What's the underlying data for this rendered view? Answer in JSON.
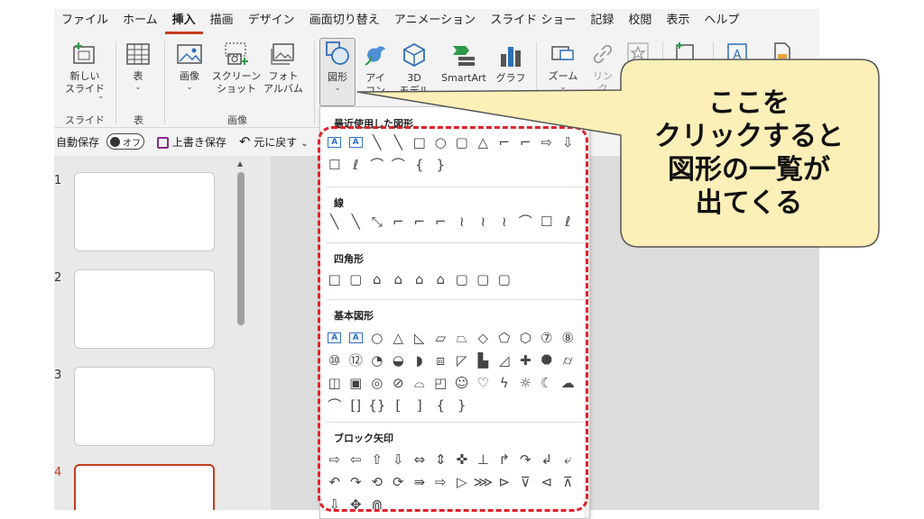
{
  "ribbon_tabs": [
    "ファイル",
    "ホーム",
    "挿入",
    "描画",
    "デザイン",
    "画面切り替え",
    "アニメーション",
    "スライド ショー",
    "記録",
    "校閲",
    "表示",
    "ヘルプ"
  ],
  "ribbon": {
    "new_slide": "新しい\nスライド",
    "table": "表",
    "image": "画像",
    "screenshot": "スクリーン\nショット",
    "photo_album": "フォト\nアルバム",
    "shapes": "図形",
    "icons": "アイ\nコン",
    "model3d": "3D\nモデル",
    "smartart": "SmartArt",
    "graph": "グラフ",
    "zoom": "ズーム",
    "link": "リン\nク",
    "group_slide": "スライド",
    "group_table": "表",
    "group_image": "画像"
  },
  "qat": {
    "autosave": "自動保存",
    "autosave_state": "オフ",
    "save": "上書き保存",
    "undo": "元に戻す"
  },
  "slides": [
    {
      "num": "1",
      "current": false
    },
    {
      "num": "2",
      "current": false
    },
    {
      "num": "3",
      "current": false
    },
    {
      "num": "4",
      "current": true
    }
  ],
  "shapes_menu": {
    "recent": {
      "title": "最近使用した図形",
      "rows": [
        [
          "A",
          "A",
          "╲",
          "╲",
          "□",
          "○",
          "▢",
          "△",
          "⌐",
          "⌐",
          "⇨",
          "⇩"
        ],
        [
          "☐",
          "ℓ",
          "⌒",
          "⌒",
          "{",
          "}"
        ]
      ]
    },
    "lines": {
      "title": "線",
      "rows": [
        [
          "╲",
          "╲",
          "⤡",
          "⌐",
          "⌐",
          "⌐",
          "≀",
          "≀",
          "≀",
          "⌒",
          "☐",
          "ℓ"
        ]
      ]
    },
    "rectangles": {
      "title": "四角形",
      "rows": [
        [
          "□",
          "▢",
          "⌂",
          "⌂",
          "⌂",
          "⌂",
          "▢",
          "▢",
          "▢"
        ]
      ]
    },
    "basic": {
      "title": "基本図形",
      "rows": [
        [
          "A",
          "A",
          "○",
          "△",
          "◺",
          "▱",
          "⏢",
          "◇",
          "⬠",
          "⬡",
          "⑦",
          "⑧"
        ],
        [
          "⑩",
          "⑫",
          "◔",
          "◒",
          "◗",
          "⧈",
          "◸",
          "▙",
          "◿",
          "✚",
          "⯃",
          "⌭"
        ],
        [
          "◫",
          "▣",
          "◎",
          "⊘",
          "⌓",
          "◰",
          "☺",
          "♡",
          "ϟ",
          "☼",
          "☾",
          "☁"
        ],
        [
          "⌒",
          "[]",
          "{}",
          "[",
          "]",
          "{",
          "}"
        ]
      ]
    },
    "block_arrows": {
      "title": "ブロック矢印",
      "rows": [
        [
          "⇨",
          "⇦",
          "⇧",
          "⇩",
          "⇔",
          "⇕",
          "✜",
          "⊥",
          "↱",
          "↷",
          "↲",
          "⤶"
        ],
        [
          "↶",
          "↷",
          "⟲",
          "⟳",
          "⇛",
          "⇨",
          "▷",
          "⋙",
          "⊳",
          "⊽",
          "⊲",
          "⊼"
        ],
        [
          "⇩",
          "✥",
          "⋒"
        ]
      ]
    }
  },
  "callout": {
    "lines": [
      "ここを",
      "クリックすると",
      "図形の一覧が",
      "出てくる"
    ]
  },
  "colors": {
    "accent": "#c43e1c",
    "highlight": "#e0212b",
    "callout_fill": "#fcefb8",
    "callout_border": "#555555"
  }
}
